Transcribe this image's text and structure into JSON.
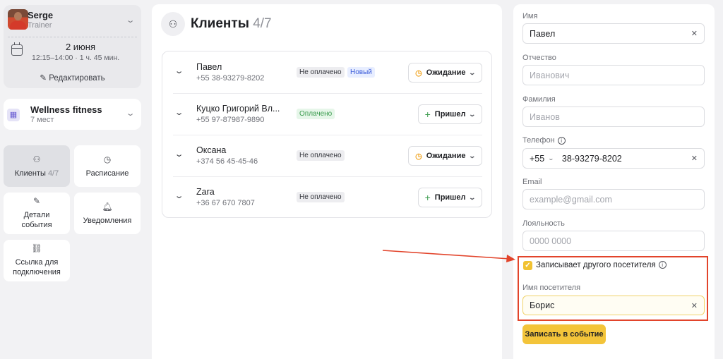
{
  "trainer": {
    "name": "Serge",
    "role": "Trainer",
    "date": "2 июня",
    "time": "12:15–14:00 · 1 ч. 45 мин.",
    "edit_label": "Редактировать"
  },
  "gym": {
    "name": "Wellness fitness",
    "places": "7 мест"
  },
  "nav": {
    "clients_label": "Клиенты",
    "clients_count": "4/7",
    "schedule_label": "Расписание",
    "details_label": "Детали события",
    "notifications_label": "Уведомления",
    "link_label": "Ссылка для подключения"
  },
  "clients": {
    "title": "Клиенты",
    "count": "4/7",
    "rows": [
      {
        "name": "Павел",
        "phone": "+55 38-93279-8202",
        "payment": "Не оплачено",
        "tag": "Новый",
        "status": "Ожидание"
      },
      {
        "name": "Куцко Григорий Вл...",
        "phone": "+55 97-87987-9890",
        "payment": "Оплачено",
        "tag": "",
        "status": "Пришел"
      },
      {
        "name": "Оксана",
        "phone": "+374 56 45-45-46",
        "payment": "Не оплачено",
        "tag": "",
        "status": "Ожидание"
      },
      {
        "name": "Zara",
        "phone": "+36 67 670 7807",
        "payment": "Не оплачено",
        "tag": "",
        "status": "Пришел"
      }
    ]
  },
  "form": {
    "first_name_label": "Имя",
    "first_name_value": "Павел",
    "middle_name_label": "Отчество",
    "middle_name_placeholder": "Иванович",
    "last_name_label": "Фамилия",
    "last_name_placeholder": "Иванов",
    "phone_label": "Телефон",
    "phone_code": "+55",
    "phone_value": "38-93279-8202",
    "email_label": "Email",
    "email_placeholder": "example@gmail.com",
    "loyalty_label": "Лояльность",
    "loyalty_placeholder": "0000 0000",
    "other_visitor_label": "Записывает другого посетителя",
    "other_visitor_checked": true,
    "visitor_name_label": "Имя посетителя",
    "visitor_name_value": "Борис",
    "submit_label": "Записать в событие"
  },
  "colors": {
    "accent": "#f3c43a",
    "highlight": "#e2442b"
  }
}
